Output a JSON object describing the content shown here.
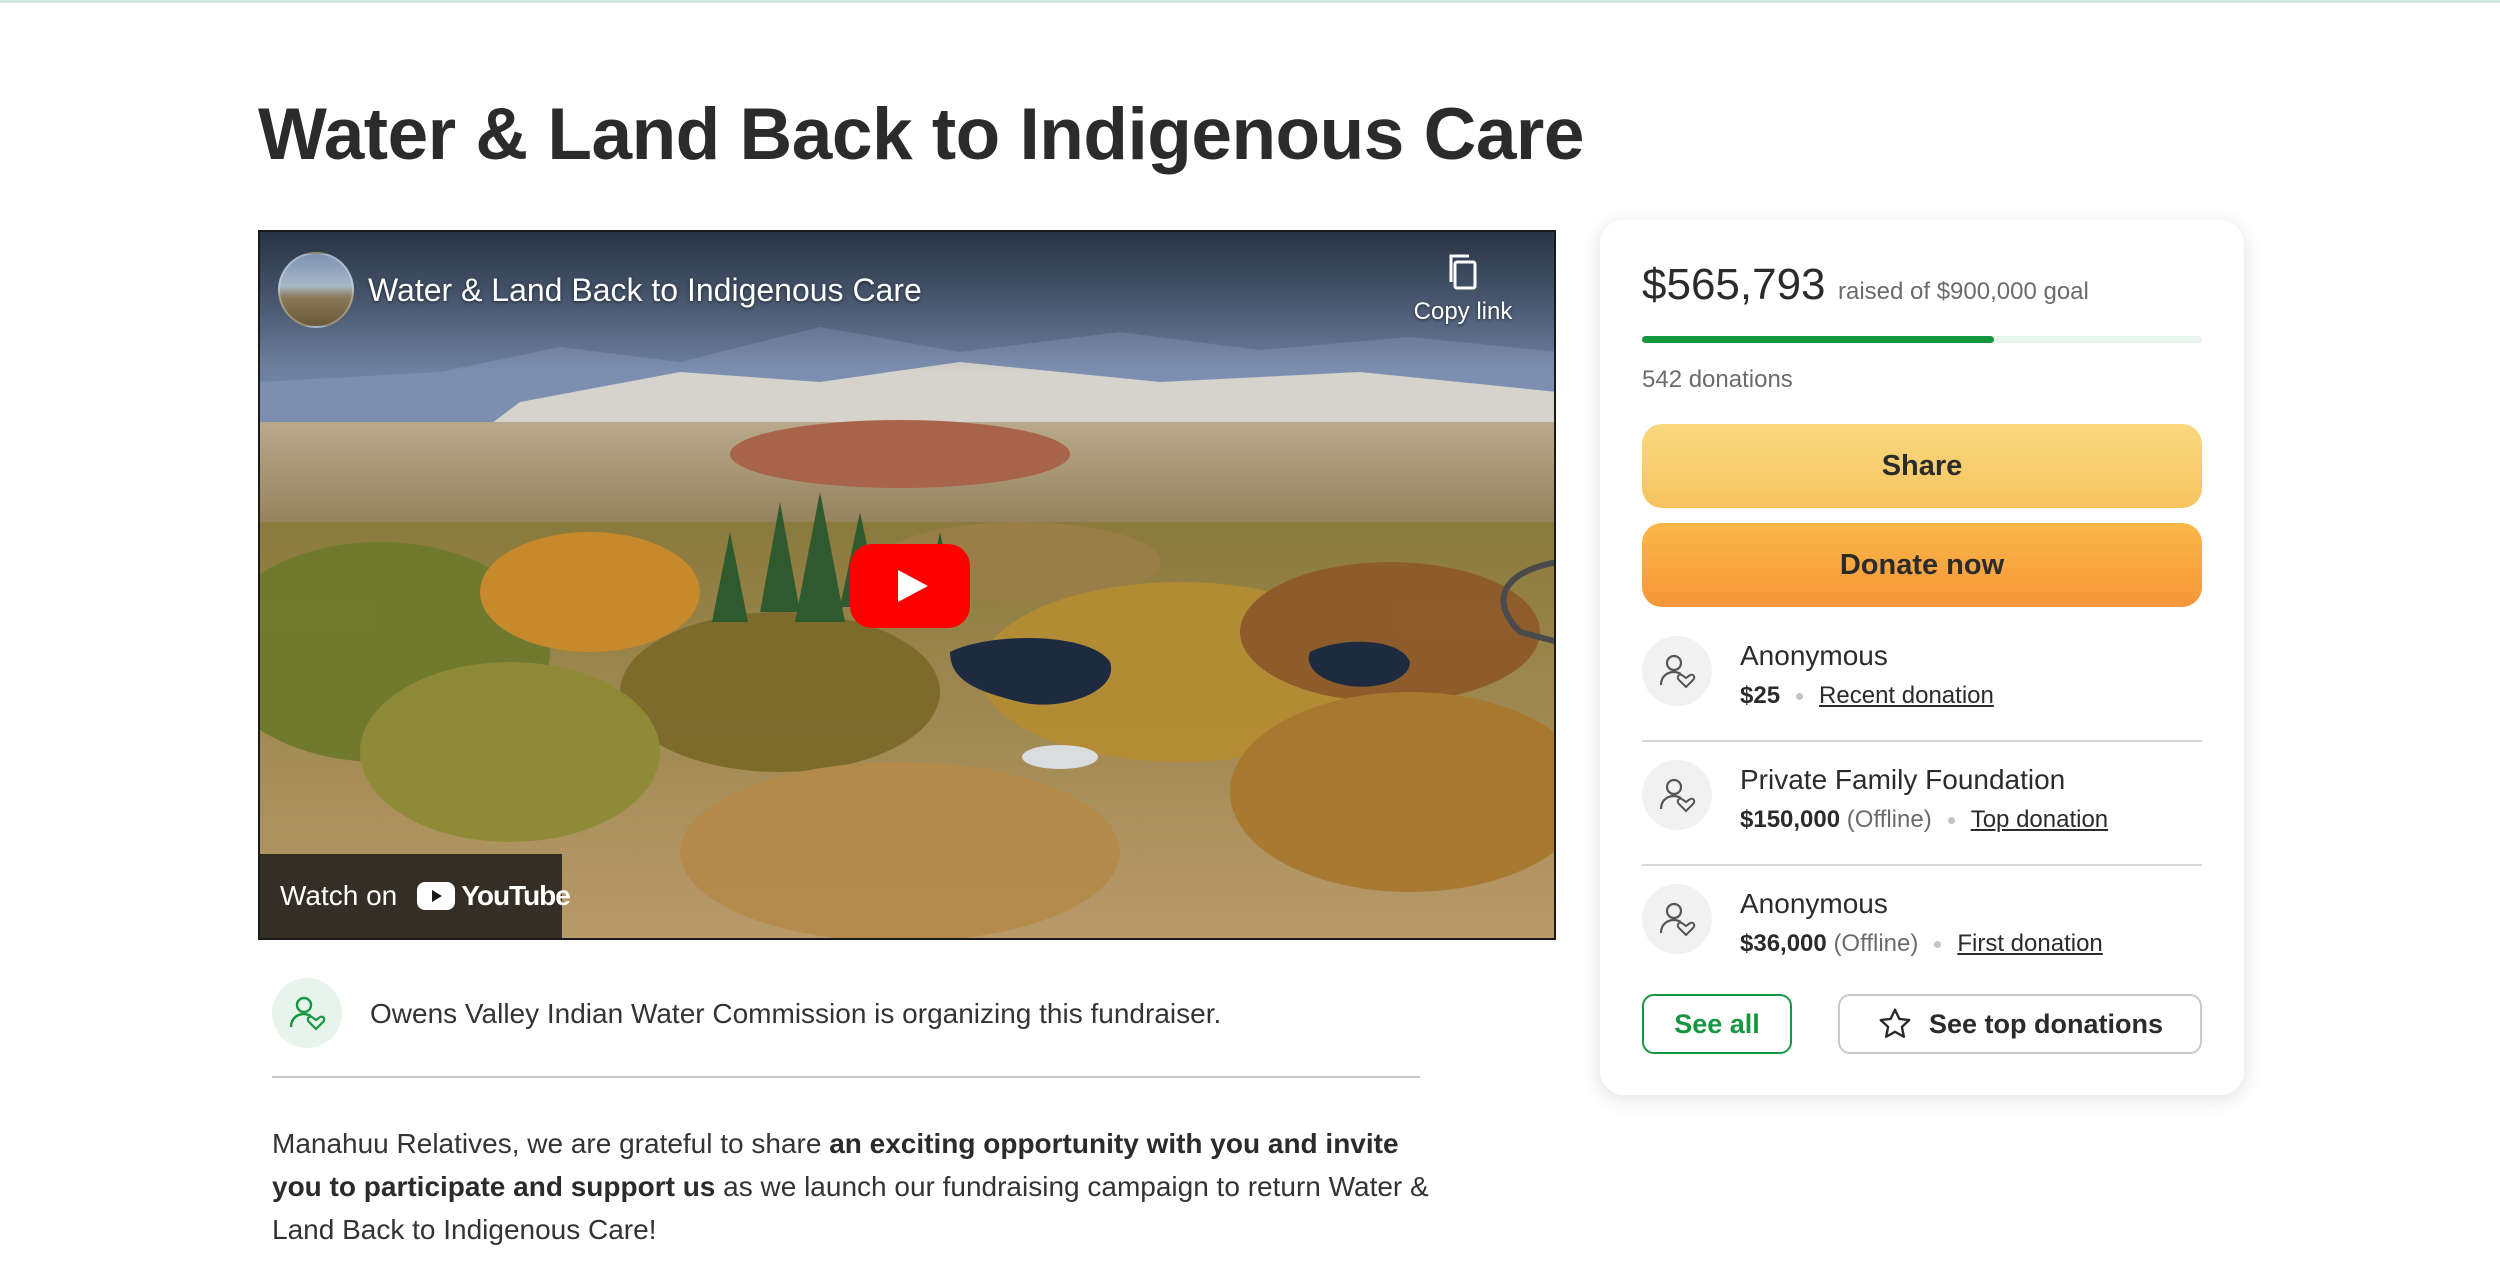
{
  "page": {
    "title": "Water & Land Back to Indigenous Care"
  },
  "video": {
    "title": "Water & Land Back to Indigenous Care",
    "copy_link_label": "Copy link",
    "watch_on_label": "Watch on",
    "youtube_label": "YouTube",
    "icons": {
      "copy": "copy-icon",
      "play": "play-icon",
      "youtube": "youtube-logo-icon"
    }
  },
  "organizer": {
    "text": "Owens Valley Indian Water Commission is organizing this fundraiser."
  },
  "story": {
    "part1": "Manahuu Relatives, we are grateful to share ",
    "part2_bold": "an exciting opportunity with you and invite you to participate and support us",
    "part3": " as we launch our fundraising campaign to return Water & Land Back to Indigenous Care!"
  },
  "campaign": {
    "raised_amount": "$565,793",
    "raised_of_text": "raised of $900,000 goal",
    "progress_fraction": 0.6287,
    "donation_count": "542 donations",
    "share_label": "Share",
    "donate_label": "Donate now",
    "see_all_label": "See all",
    "see_top_label": "See top donations"
  },
  "donors": [
    {
      "name": "Anonymous",
      "amount": "$25",
      "offline": "",
      "tag": "Recent donation"
    },
    {
      "name": "Private Family Foundation",
      "amount": "$150,000",
      "offline": "(Offline)",
      "tag": "Top donation"
    },
    {
      "name": "Anonymous",
      "amount": "$36,000",
      "offline": "(Offline)",
      "tag": "First donation"
    }
  ],
  "colors": {
    "accent_green": "#16963f",
    "share_yellow": "#f6c35f",
    "donate_orange": "#f5963a",
    "youtube_red": "#ff0000"
  }
}
